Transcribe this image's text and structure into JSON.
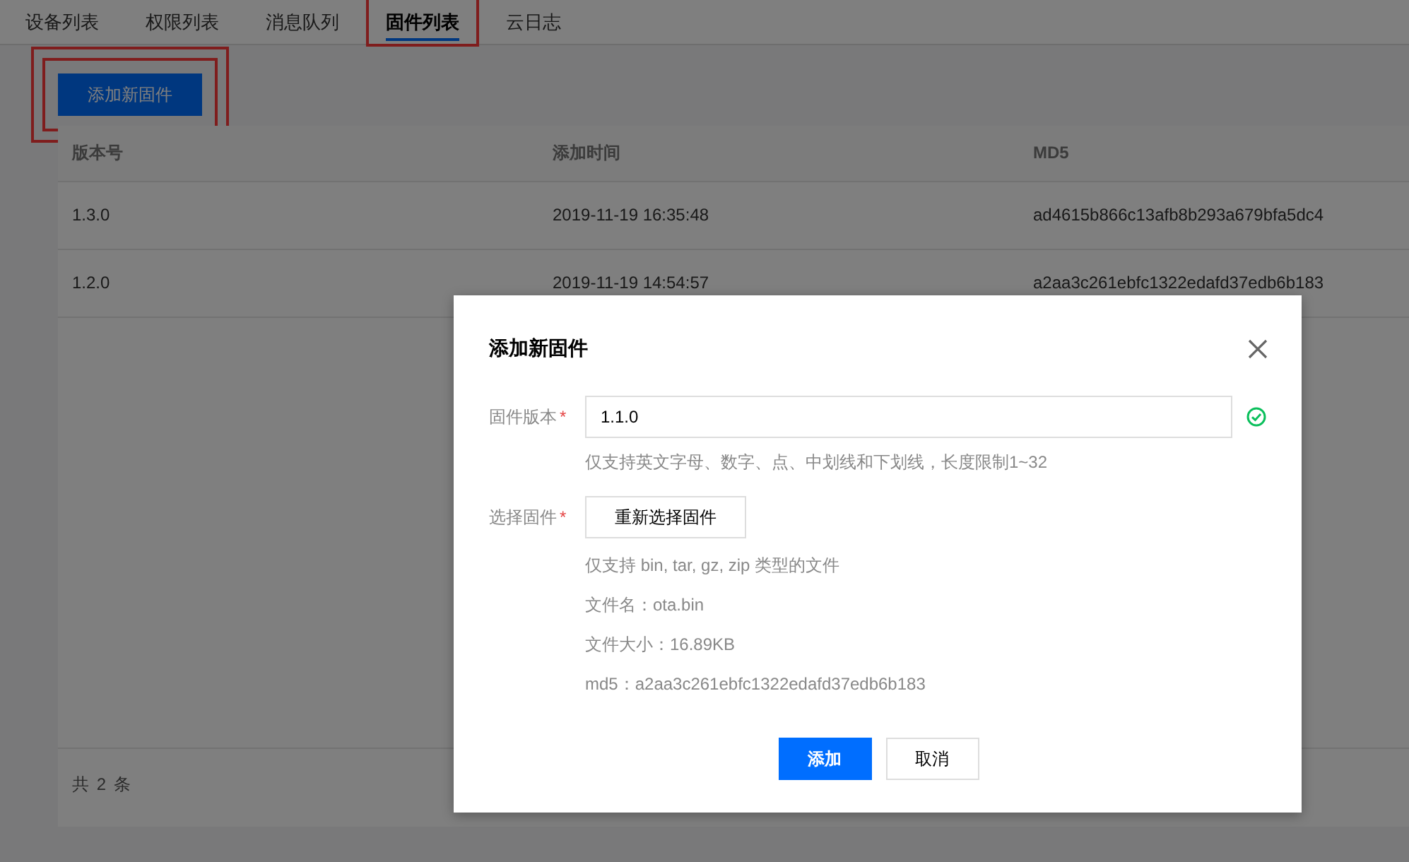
{
  "tabs": [
    {
      "label": "设备列表",
      "selected": false,
      "highlighted": false
    },
    {
      "label": "权限列表",
      "selected": false,
      "highlighted": false
    },
    {
      "label": "消息队列",
      "selected": false,
      "highlighted": false
    },
    {
      "label": "固件列表",
      "selected": true,
      "highlighted": true
    },
    {
      "label": "云日志",
      "selected": false,
      "highlighted": false
    }
  ],
  "add_button": {
    "label": "添加新固件",
    "highlighted": true
  },
  "table": {
    "columns": [
      "版本号",
      "添加时间",
      "MD5"
    ],
    "rows": [
      [
        "1.3.0",
        "2019-11-19 16:35:48",
        "ad4615b866c13afb8b293a679bfa5dc4"
      ],
      [
        "1.2.0",
        "2019-11-19 14:54:57",
        "a2aa3c261ebfc1322edafd37edb6b183"
      ]
    ],
    "footer": "共 2 条"
  },
  "dialog": {
    "title": "添加新固件",
    "version_field": {
      "label": "固件版本",
      "required_mark": "*",
      "value": "1.1.0",
      "valid": true,
      "hint": "仅支持英文字母、数字、点、中划线和下划线，长度限制1~32"
    },
    "file_field": {
      "label": "选择固件",
      "required_mark": "*",
      "button": "重新选择固件",
      "notes": [
        "仅支持 bin, tar, gz, zip 类型的文件",
        "文件名：ota.bin",
        "文件大小：16.89KB",
        "md5：a2aa3c261ebfc1322edafd37edb6b183"
      ]
    },
    "buttons": [
      {
        "label": "添加",
        "kind": "primary"
      },
      {
        "label": "取消",
        "kind": "secondary"
      }
    ]
  }
}
